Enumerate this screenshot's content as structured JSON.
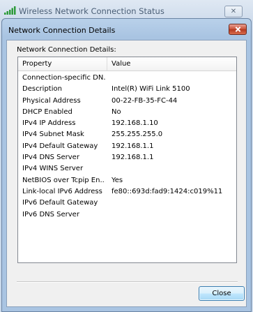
{
  "background_window": {
    "title": "Wireless Network Connection Status",
    "close_glyph": "✕",
    "icon": "wireless-signal-icon"
  },
  "dialog": {
    "title": "Network Connection Details",
    "close_icon": "close-icon",
    "section_label": "Network Connection Details:",
    "columns": {
      "property": "Property",
      "value": "Value"
    },
    "rows": [
      {
        "property": "Connection-specific DN...",
        "value": ""
      },
      {
        "property": "Description",
        "value": "Intel(R) WiFi Link 5100"
      },
      {
        "property": "Physical Address",
        "value": "00-22-FB-35-FC-44"
      },
      {
        "property": "DHCP Enabled",
        "value": "No"
      },
      {
        "property": "IPv4 IP Address",
        "value": "192.168.1.10"
      },
      {
        "property": "IPv4 Subnet Mask",
        "value": "255.255.255.0"
      },
      {
        "property": "IPv4 Default Gateway",
        "value": "192.168.1.1"
      },
      {
        "property": "IPv4 DNS Server",
        "value": "192.168.1.1"
      },
      {
        "property": "IPv4 WINS Server",
        "value": ""
      },
      {
        "property": "NetBIOS over Tcpip En...",
        "value": "Yes"
      },
      {
        "property": "Link-local IPv6 Address",
        "value": "fe80::693d:fad9:1424:c019%11"
      },
      {
        "property": "IPv6 Default Gateway",
        "value": ""
      },
      {
        "property": "IPv6 DNS Server",
        "value": ""
      }
    ],
    "close_button_label": "Close"
  }
}
